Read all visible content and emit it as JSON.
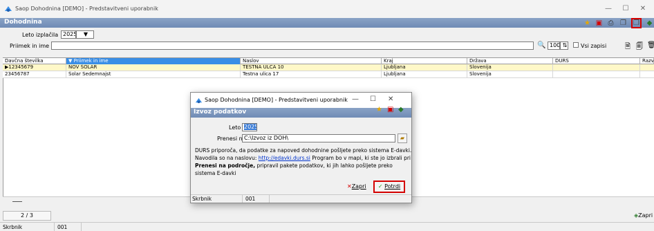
{
  "window": {
    "title": "Saop Dohodnina [DEMO] - Predstavitveni uporabnik"
  },
  "module": {
    "title": "Dohodnina"
  },
  "filters": {
    "year_label": "Leto izplačila",
    "year_value": "2025",
    "search_label": "Priimek in ime",
    "search_value": "",
    "count_value": "100",
    "all_records_label": "Vsi zapisi"
  },
  "table": {
    "columns": [
      "Davčna številka",
      "Priimek in ime",
      "Naslov",
      "Kraj",
      "Država",
      "DURS",
      "Razvr"
    ],
    "rows": [
      {
        "tax": "12345679",
        "name": "NOV ŠOLAR",
        "address": "TESTNA ULCA 10",
        "city": "Ljubljana",
        "country": "Slovenija"
      },
      {
        "tax": "23456787",
        "name": "Šolar Sedemnajst",
        "address": "Testna ulica 17",
        "city": "Ljubljana",
        "country": "Slovenija"
      }
    ]
  },
  "footer": {
    "pager": "2 / 3",
    "close_label": "Zapri",
    "custodian_label": "Skrbnik",
    "custodian_value": "001"
  },
  "dialog": {
    "window_title": "Saop Dohodnina [DEMO] - Predstavitveni uporabnik",
    "title": "Izvoz podatkov",
    "year_label": "Leto",
    "year_value": "2025",
    "transfer_label": "Prenesi na",
    "transfer_value": "C:\\Izvoz iz DOH\\",
    "text_line1": "DURS priporoča, da podatke za napoved dohodnine pošljete preko sistema E-davki.",
    "text_line2a": "Navodila so na naslovu:",
    "link": "http://edavki.durs.si",
    "text_line2b": "Program bo v mapi, ki ste jo izbrali pri",
    "text_line3a": "Prenesi na področje,",
    "text_line3b": "pripravil pakete podatkov, ki jih lahko pošljete preko",
    "text_line4": "sistema E-davki",
    "close_label": "Zapri",
    "confirm_label": "Potrdi",
    "custodian_label": "Skrbnik",
    "custodian_value": "001"
  },
  "colors": {
    "header_blue": "#6f8bb5",
    "selected_row": "#fff8c8",
    "sort_column": "#3a8ee6",
    "highlight_red": "#d40000"
  }
}
